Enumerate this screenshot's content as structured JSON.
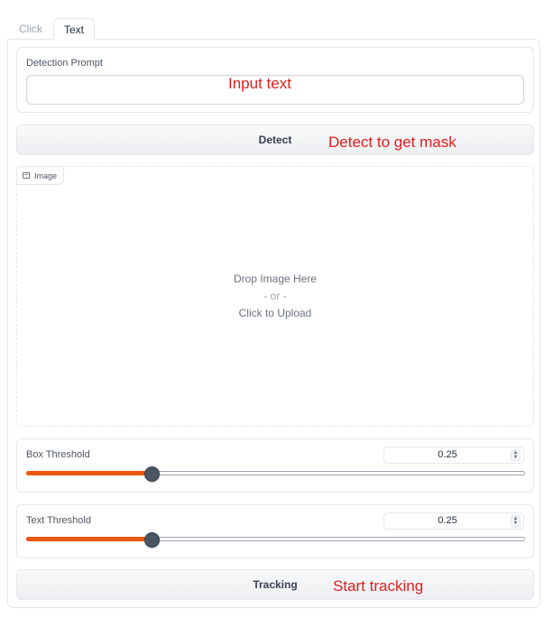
{
  "tabs": [
    {
      "label": "Click",
      "active": false
    },
    {
      "label": "Text",
      "active": true
    }
  ],
  "detection_prompt": {
    "label": "Detection Prompt",
    "value": ""
  },
  "detect_button": {
    "label": "Detect"
  },
  "image_upload": {
    "label": "Image",
    "icon": "image-icon",
    "drop_text": "Drop Image Here",
    "or_text": "- or -",
    "click_text": "Click to Upload"
  },
  "box_threshold": {
    "label": "Box Threshold",
    "value": "0.25",
    "level": 0.25
  },
  "text_threshold": {
    "label": "Text Threshold",
    "value": "0.25",
    "level": 0.25
  },
  "tracking_button": {
    "label": "Tracking"
  },
  "annotations": {
    "input_text": "Input text",
    "detect": "Detect to get mask",
    "tracking": "Start tracking"
  },
  "colors": {
    "accent": "#ea580c",
    "annotation": "#e11d1d",
    "thumb": "#4b5563"
  }
}
